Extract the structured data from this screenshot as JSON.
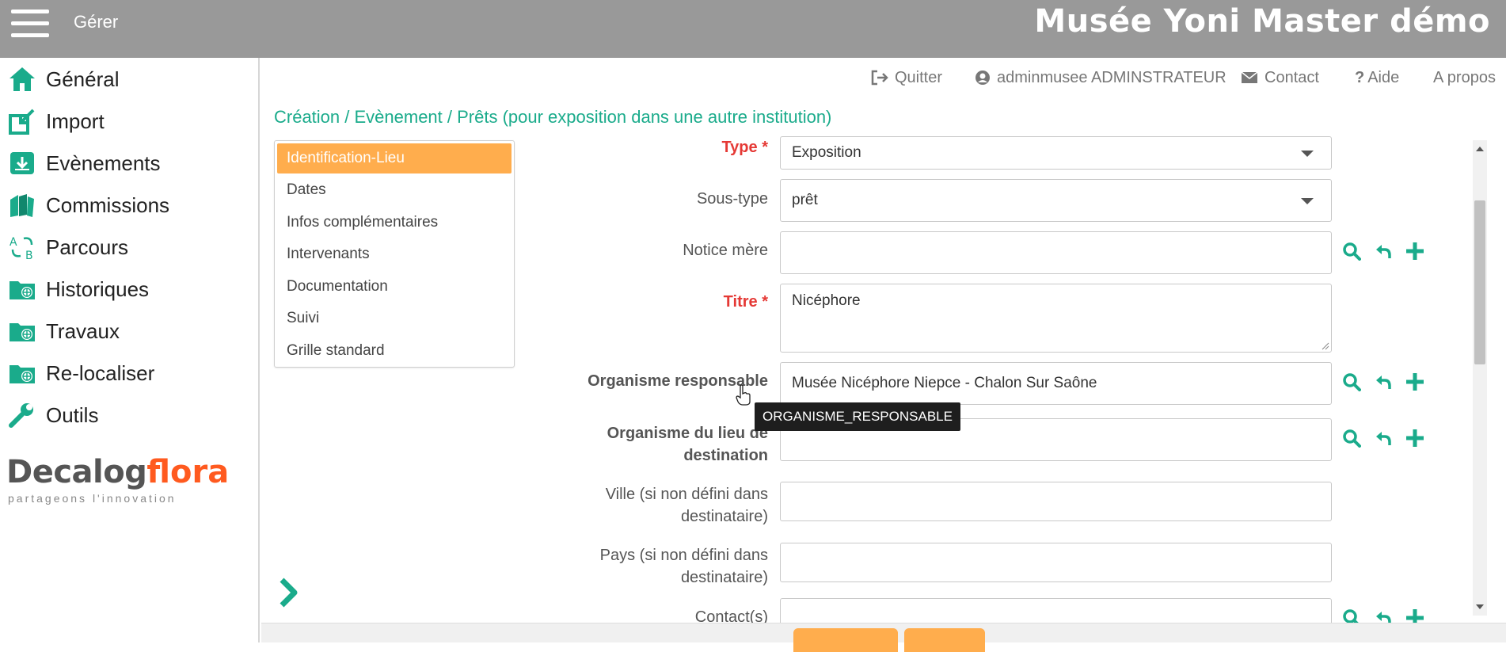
{
  "header": {
    "menu_label": "Gérer",
    "app_title": "Musée Yoni Master démo"
  },
  "sidebar": {
    "items": [
      {
        "label": "Général",
        "icon": "home-icon"
      },
      {
        "label": "Import",
        "icon": "import-icon"
      },
      {
        "label": "Evènements",
        "icon": "download-box-icon"
      },
      {
        "label": "Commissions",
        "icon": "books-icon"
      },
      {
        "label": "Parcours",
        "icon": "route-icon"
      },
      {
        "label": "Historiques",
        "icon": "folder-globe-icon"
      },
      {
        "label": "Travaux",
        "icon": "folder-globe-icon"
      },
      {
        "label": "Re-localiser",
        "icon": "folder-globe-icon"
      },
      {
        "label": "Outils",
        "icon": "wrench-icon"
      }
    ],
    "logo": {
      "decalog": "Decalog",
      "flora": "flora",
      "tagline": "partageons l'innovation"
    }
  },
  "toplinks": {
    "quit": "Quitter",
    "user": "adminmusee ADMINSTRATEUR",
    "contact": "Contact",
    "help": "Aide",
    "about": "A propos"
  },
  "breadcrumb": "Création / Evènement / Prêts (pour exposition dans une autre institution)",
  "tabs": [
    "Identification-Lieu",
    "Dates",
    "Infos complémentaires",
    "Intervenants",
    "Documentation",
    "Suivi",
    "Grille standard"
  ],
  "form": {
    "type": {
      "label": "Type *",
      "value": "Exposition"
    },
    "sous_type": {
      "label": "Sous-type",
      "value": "prêt"
    },
    "notice_mere": {
      "label": "Notice mère",
      "value": ""
    },
    "titre": {
      "label": "Titre *",
      "value": "Nicéphore"
    },
    "organisme_responsable": {
      "label": "Organisme responsable",
      "value": "Musée Nicéphore Niepce - Chalon Sur Saône"
    },
    "organisme_destination": {
      "label": "Organisme du lieu de destination",
      "value": ""
    },
    "ville": {
      "label": "Ville (si non défini dans destinataire)",
      "value": ""
    },
    "pays": {
      "label": "Pays (si non défini dans destinataire)",
      "value": ""
    },
    "contacts": {
      "label": "Contact(s)",
      "value": ""
    }
  },
  "tooltip": "ORGANISME_RESPONSABLE",
  "colors": {
    "topbar": "#999999",
    "accent": "#1aab8b",
    "active_tab": "#ffad4d",
    "required": "#e53935",
    "brand_orange": "#ff5a1f"
  }
}
